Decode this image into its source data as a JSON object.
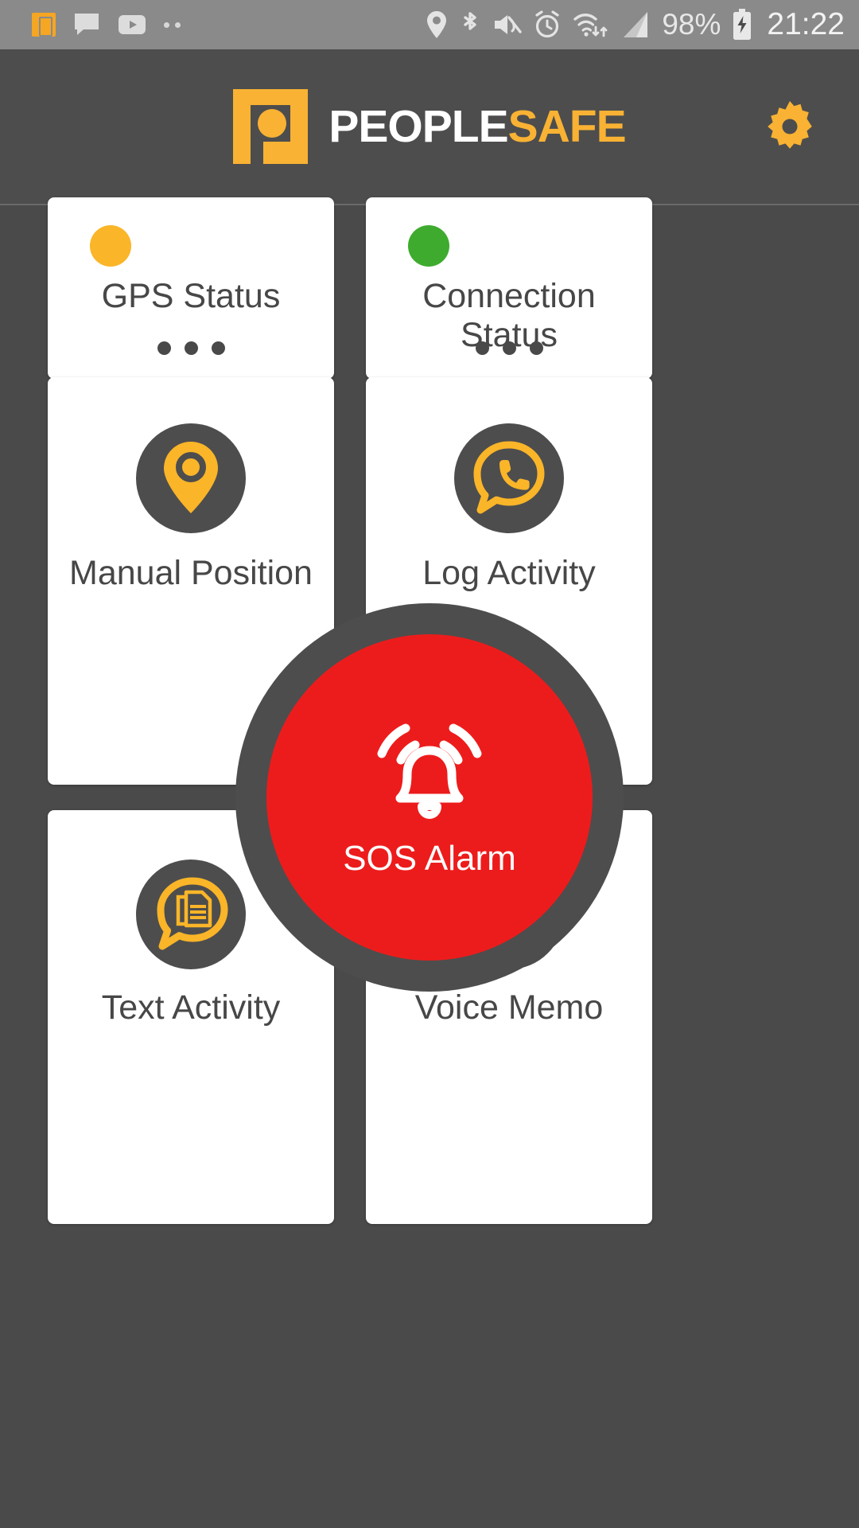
{
  "statusbar": {
    "left_icons": [
      {
        "name": "peoplesafe-app-icon",
        "glyph": "ps"
      },
      {
        "name": "message-icon",
        "glyph": "chat"
      },
      {
        "name": "youtube-icon",
        "glyph": "play"
      },
      {
        "name": "more-notifications-icon",
        "glyph": "dots"
      }
    ],
    "right_icons": [
      {
        "name": "location-icon",
        "glyph": "pin"
      },
      {
        "name": "bluetooth-icon",
        "glyph": "bt"
      },
      {
        "name": "mute-icon",
        "glyph": "mute"
      },
      {
        "name": "alarm-icon",
        "glyph": "alarm"
      },
      {
        "name": "wifi-data-icon",
        "glyph": "wifi"
      },
      {
        "name": "signal-icon",
        "glyph": "signal"
      }
    ],
    "battery_percent": "98%",
    "battery_state": "charging",
    "time": "21:22"
  },
  "header": {
    "brand_primary": "PEOPLE",
    "brand_secondary": "SAFE",
    "logo_name": "peoplesafe-logo",
    "settings_label": "Settings"
  },
  "status_cards": [
    {
      "name": "gps-status-card",
      "label": "GPS Status",
      "dot_color": "#fab528",
      "dot_state": "amber",
      "menu": "•••"
    },
    {
      "name": "connection-status-card",
      "label": "Connection Status",
      "dot_color": "#3eab2e",
      "dot_state": "green",
      "menu": "•••"
    }
  ],
  "actions": [
    {
      "name": "manual-position-card",
      "label": "Manual Position",
      "icon": "map-pin-icon"
    },
    {
      "name": "log-activity-card",
      "label": "Log Activity",
      "icon": "call-bubble-icon"
    },
    {
      "name": "text-activity-card",
      "label": "Text Activity",
      "icon": "document-bubble-icon"
    },
    {
      "name": "voice-memo-card",
      "label": "Voice Memo",
      "icon": "speech-bubble-icon"
    }
  ],
  "sos": {
    "label": "SOS Alarm",
    "icon": "ringing-bell-icon",
    "color": "#ed1c1c"
  },
  "colors": {
    "background": "#4a4a4a",
    "header": "#4d4d4d",
    "statusbar": "#8a8a8a",
    "accent": "#f9b233",
    "card": "#ffffff",
    "text_dark": "#474747",
    "alert": "#ed1c1c",
    "ok": "#3eab2e"
  }
}
